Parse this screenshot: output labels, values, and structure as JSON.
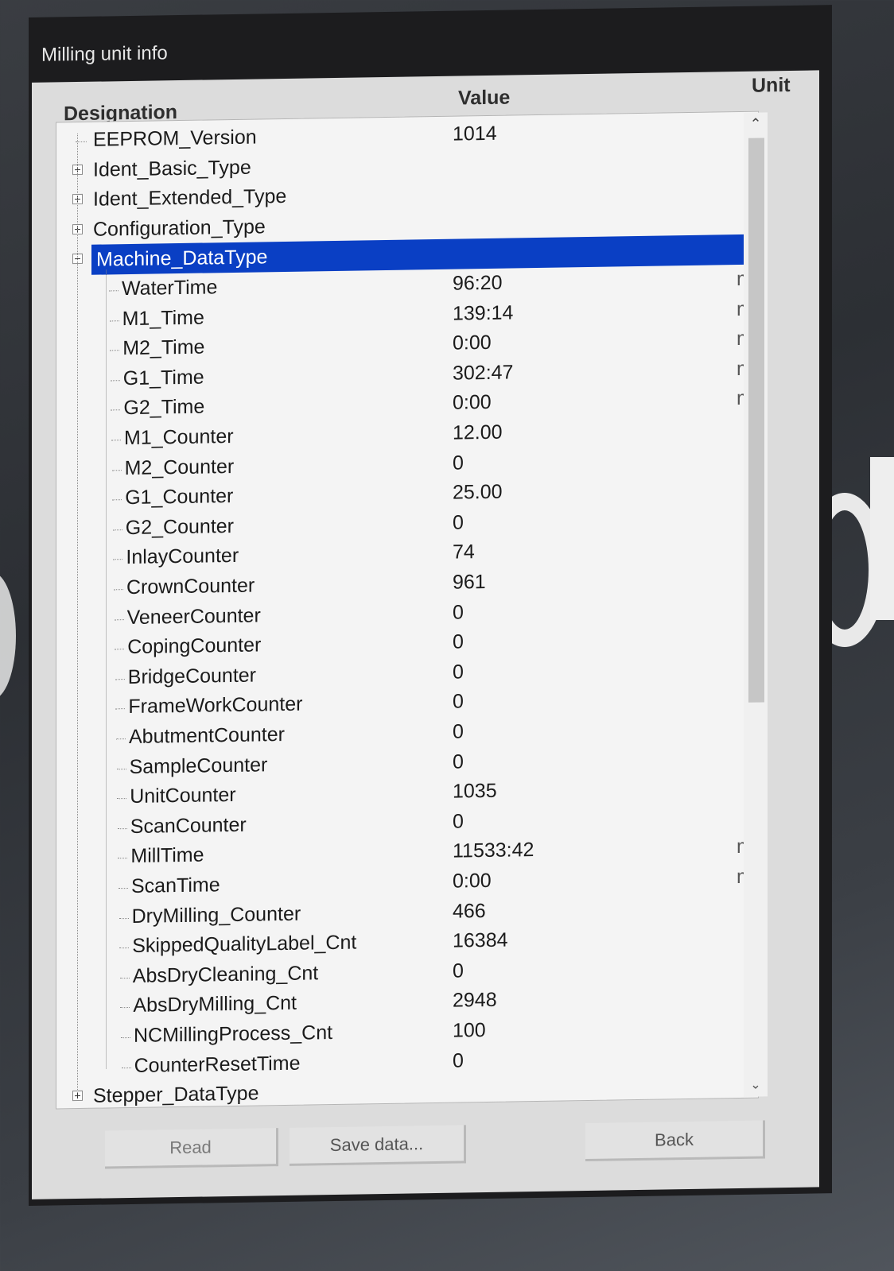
{
  "window": {
    "title": "Milling unit info"
  },
  "columns": {
    "designation": "Designation",
    "value": "Value",
    "unit": "Unit"
  },
  "tree": {
    "top_items": [
      {
        "label": "EEPROM_Version",
        "value": "1014",
        "expander": "none"
      },
      {
        "label": "Ident_Basic_Type",
        "value": "",
        "expander": "plus"
      },
      {
        "label": "Ident_Extended_Type",
        "value": "",
        "expander": "plus"
      },
      {
        "label": "Configuration_Type",
        "value": "",
        "expander": "plus"
      },
      {
        "label": "Machine_DataType",
        "value": "",
        "expander": "minus",
        "selected": true
      }
    ],
    "machine_children": [
      {
        "label": "WaterTime",
        "value": "96:20",
        "unit": "mi"
      },
      {
        "label": "M1_Time",
        "value": "139:14",
        "unit": "mi"
      },
      {
        "label": "M2_Time",
        "value": "0:00",
        "unit": "mi"
      },
      {
        "label": "G1_Time",
        "value": "302:47",
        "unit": "mi"
      },
      {
        "label": "G2_Time",
        "value": "0:00",
        "unit": "mi"
      },
      {
        "label": "M1_Counter",
        "value": "12.00",
        "unit": ""
      },
      {
        "label": "M2_Counter",
        "value": "0",
        "unit": ""
      },
      {
        "label": "G1_Counter",
        "value": "25.00",
        "unit": ""
      },
      {
        "label": "G2_Counter",
        "value": "0",
        "unit": ""
      },
      {
        "label": "InlayCounter",
        "value": "74",
        "unit": ""
      },
      {
        "label": "CrownCounter",
        "value": "961",
        "unit": ""
      },
      {
        "label": "VeneerCounter",
        "value": "0",
        "unit": ""
      },
      {
        "label": "CopingCounter",
        "value": "0",
        "unit": ""
      },
      {
        "label": "BridgeCounter",
        "value": "0",
        "unit": ""
      },
      {
        "label": "FrameWorkCounter",
        "value": "0",
        "unit": ""
      },
      {
        "label": "AbutmentCounter",
        "value": "0",
        "unit": ""
      },
      {
        "label": "SampleCounter",
        "value": "0",
        "unit": ""
      },
      {
        "label": "UnitCounter",
        "value": "1035",
        "unit": ""
      },
      {
        "label": "ScanCounter",
        "value": "0",
        "unit": ""
      },
      {
        "label": "MillTime",
        "value": "11533:42",
        "unit": "mi"
      },
      {
        "label": "ScanTime",
        "value": "0:00",
        "unit": "mi"
      },
      {
        "label": "DryMilling_Counter",
        "value": "466",
        "unit": ""
      },
      {
        "label": "SkippedQualityLabel_Cnt",
        "value": "16384",
        "unit": ""
      },
      {
        "label": "AbsDryCleaning_Cnt",
        "value": "0",
        "unit": ""
      },
      {
        "label": "AbsDryMilling_Cnt",
        "value": "2948",
        "unit": ""
      },
      {
        "label": "NCMillingProcess_Cnt",
        "value": "100",
        "unit": ""
      },
      {
        "label": "CounterResetTime",
        "value": "0",
        "unit": ""
      }
    ],
    "after_items": [
      {
        "label": "Stepper_DataType",
        "value": "",
        "expander": "plus"
      }
    ]
  },
  "buttons": {
    "read": "Read",
    "save": "Save data...",
    "back": "Back"
  },
  "colors": {
    "selection": "#0a3fc4",
    "window_bg": "#dcdcdc",
    "titlebar": "#1c1c1e"
  }
}
